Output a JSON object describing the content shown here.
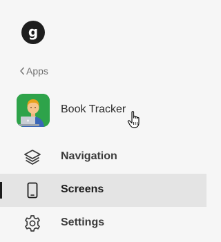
{
  "logo": {
    "letter": "g"
  },
  "back_link": {
    "label": "Apps"
  },
  "app": {
    "name": "Book Tracker",
    "icon": "developer-avatar-icon",
    "icon_bg": "#2ea34a"
  },
  "nav": {
    "items": [
      {
        "label": "Navigation",
        "icon": "layers-icon",
        "active": false
      },
      {
        "label": "Screens",
        "icon": "phone-icon",
        "active": true
      },
      {
        "label": "Settings",
        "icon": "gear-icon",
        "active": false
      }
    ]
  },
  "colors": {
    "background": "#f6f6f6",
    "active_background": "#e4e4e4",
    "active_indicator": "#1b1b1b",
    "muted_text": "#6f6f6f"
  }
}
